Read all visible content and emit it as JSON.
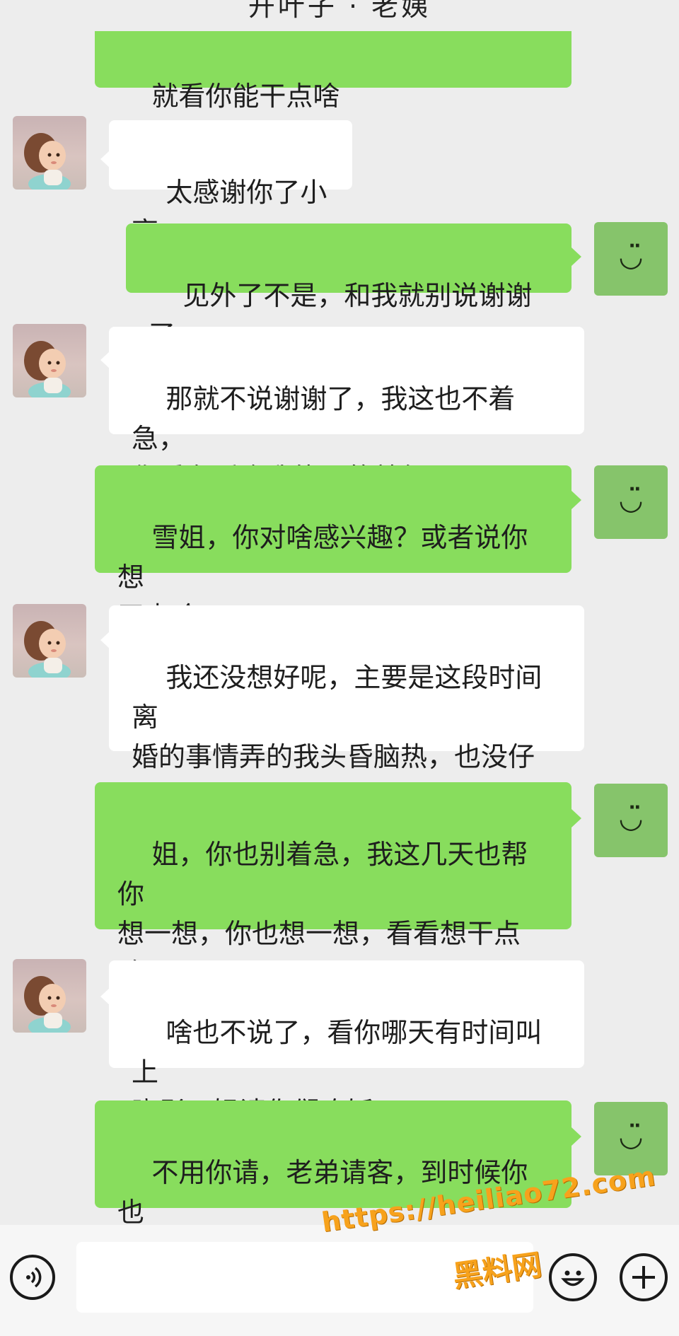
{
  "header": {
    "title": "开叶子 · 老姨"
  },
  "messages": [
    {
      "side": "out",
      "text": "就看你能干点啥",
      "partial": true
    },
    {
      "side": "in",
      "text": "太感谢你了小亮"
    },
    {
      "side": "out",
      "text": "见外了不是，和我就别说谢谢了"
    },
    {
      "side": "in",
      "text": "那就不说谢谢了，我这也不着急，\n你看有适合我能干的就行。"
    },
    {
      "side": "out",
      "text": "雪姐，你对啥感兴趣？或者说你想\n干点啥？"
    },
    {
      "side": "in",
      "text": "我还没想好呢，主要是这段时间离\n婚的事情弄的我头昏脑热，也没仔\n细的想想"
    },
    {
      "side": "out",
      "text": "姐，你也别着急，我这几天也帮你\n想一想，你也想一想，看看想干点\n啥"
    },
    {
      "side": "in",
      "text": "啥也不说了，看你哪天有时间叫上\n晓彤，姐请你们吃饭"
    },
    {
      "side": "out",
      "text": "不用你请，老弟请客，到时候你也\n把孩子带上"
    }
  ],
  "self_avatar": {
    "icon": "smile-icon",
    "glyph": "◡̈",
    "color": "#86c46b"
  },
  "input_bar": {
    "placeholder": "",
    "voice_icon": "voice-icon",
    "emoji_icon": "emoji-icon",
    "plus_icon": "plus-icon"
  },
  "watermark": {
    "url": "https://heiliao72.com",
    "name": "黑料网"
  },
  "colors": {
    "background": "#ededed",
    "outgoing_bubble": "#88dd5d",
    "incoming_bubble": "#ffffff",
    "watermark": "#f7a21c"
  }
}
